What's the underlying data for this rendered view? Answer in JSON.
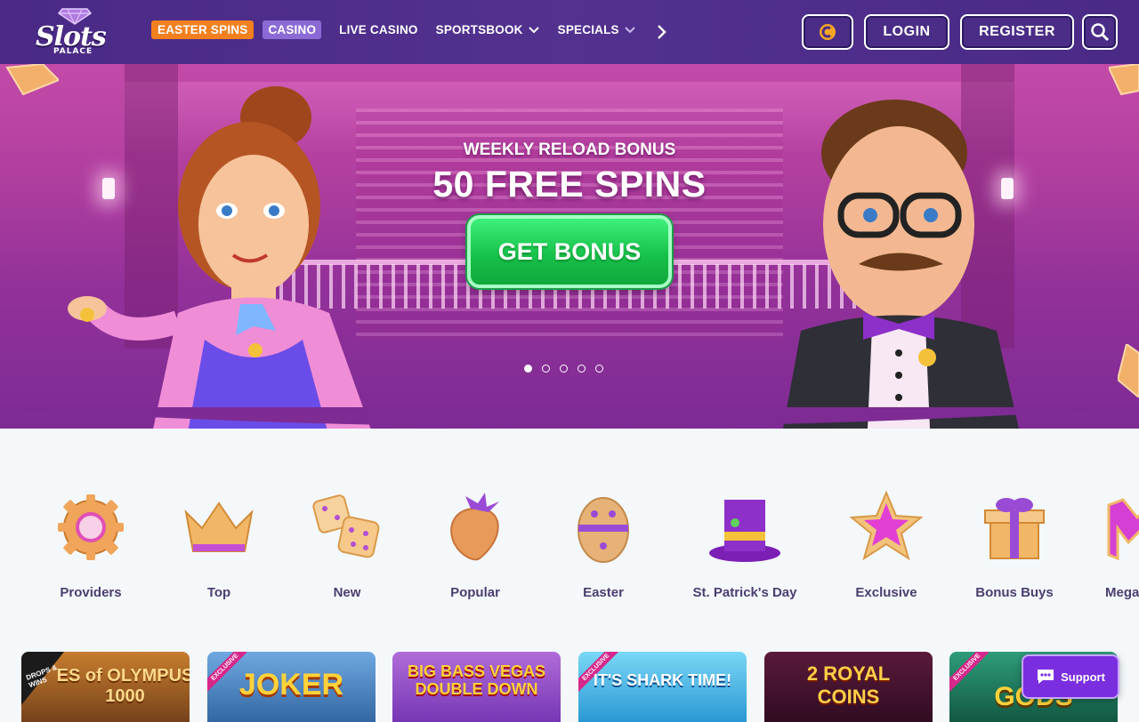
{
  "header": {
    "logo_text": "Slots",
    "logo_sub": "PALACE",
    "nav": [
      {
        "label": "EASTER SPINS"
      },
      {
        "label": "CASINO"
      },
      {
        "label": "LIVE CASINO"
      },
      {
        "label": "SPORTSBOOK"
      },
      {
        "label": "SPECIALS"
      }
    ],
    "login_label": "LOGIN",
    "register_label": "REGISTER"
  },
  "hero": {
    "subtitle": "WEEKLY RELOAD BONUS",
    "title": "50 FREE SPINS",
    "cta_label": "GET BONUS",
    "slides": 5,
    "active_slide": 1
  },
  "categories": [
    {
      "label": "Providers",
      "icon": "gear-icon"
    },
    {
      "label": "Top",
      "icon": "crown-icon"
    },
    {
      "label": "New",
      "icon": "dice-icon"
    },
    {
      "label": "Popular",
      "icon": "strawberry-icon"
    },
    {
      "label": "Easter",
      "icon": "egg-icon"
    },
    {
      "label": "St. Patrick's Day",
      "icon": "leprechaun-hat-icon"
    },
    {
      "label": "Exclusive",
      "icon": "star-icon"
    },
    {
      "label": "Bonus Buys",
      "icon": "gift-icon"
    },
    {
      "label": "Mega",
      "icon": "mega-icon"
    }
  ],
  "games": [
    {
      "title": "ES of OLYMPUS 1000",
      "badge": "DROPS & WINS"
    },
    {
      "title": "JOKER",
      "badge": "EXCLUSIVE"
    },
    {
      "title": "BIG BASS VEGAS DOUBLE DOWN",
      "badge": ""
    },
    {
      "title": "IT'S SHARK TIME!",
      "badge": "EXCLUSIVE"
    },
    {
      "title": "2 ROYAL COINS",
      "badge": ""
    },
    {
      "title": "GODS",
      "badge": "EXCLUSIVE"
    }
  ],
  "support_label": "Support",
  "colors": {
    "header_bg": "#4a2a86",
    "accent_orange": "#f2801f",
    "accent_purple": "#8b6ad6",
    "cta_green": "#17c24a",
    "category_text": "#4a3e70"
  }
}
